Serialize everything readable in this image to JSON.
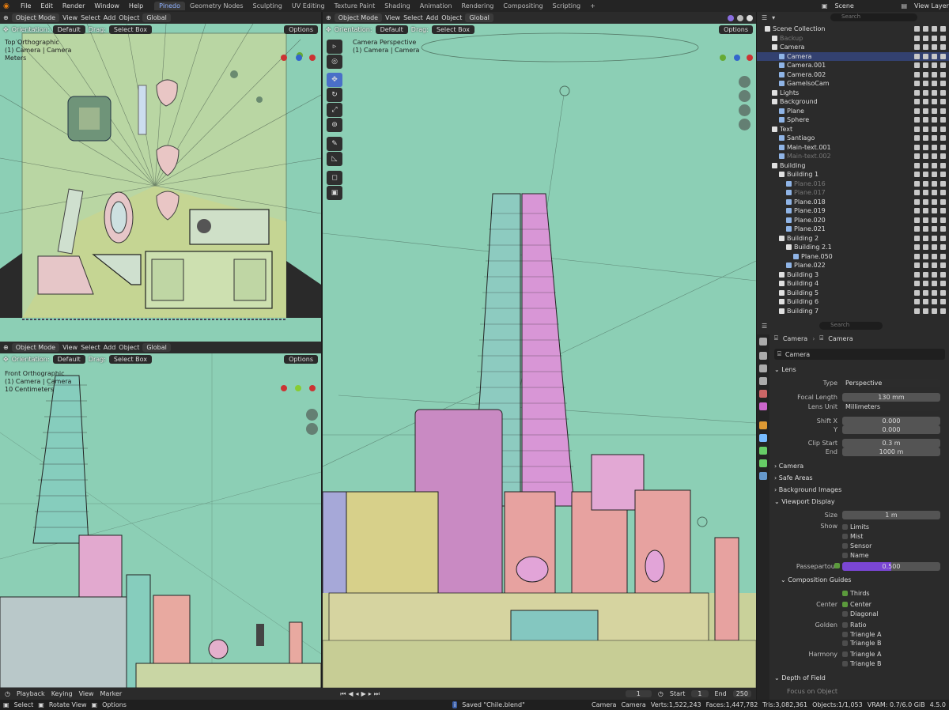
{
  "menu": [
    "File",
    "Edit",
    "Render",
    "Window",
    "Help"
  ],
  "workspaces": [
    "Pinedo",
    "Geometry Nodes",
    "Sculpting",
    "UV Editing",
    "Texture Paint",
    "Shading",
    "Animation",
    "Rendering",
    "Compositing",
    "Scripting"
  ],
  "active_workspace": "Pinedo",
  "scene": "Scene",
  "view_layer": "View Layer",
  "header": {
    "mode": "Object Mode",
    "view": "View",
    "select": "Select",
    "add": "Add",
    "object": "Object",
    "transform": "Global",
    "orientation_label": "Orientation:",
    "orientation": "Default",
    "drag_label": "Drag:",
    "drag": "Select Box",
    "options": "Options"
  },
  "viewports": {
    "top": {
      "name": "Top Orthographic",
      "obj": "(1) Camera | Camera",
      "unit": "Meters"
    },
    "front": {
      "name": "Front Orthographic",
      "obj": "(1) Camera | Camera",
      "unit": "10 Centimeters"
    },
    "cam": {
      "name": "Camera Perspective",
      "obj": "(1) Camera | Camera"
    }
  },
  "outliner": {
    "search_placeholder": "Search",
    "rows": [
      {
        "d": 0,
        "t": "Scene Collection",
        "k": "coll"
      },
      {
        "d": 1,
        "t": "Backup",
        "k": "coll",
        "dim": true
      },
      {
        "d": 1,
        "t": "Camera",
        "k": "coll"
      },
      {
        "d": 2,
        "t": "Camera",
        "k": "cam",
        "sel": true
      },
      {
        "d": 2,
        "t": "Camera.001",
        "k": "cam"
      },
      {
        "d": 2,
        "t": "Camera.002",
        "k": "cam"
      },
      {
        "d": 2,
        "t": "GameIsoCam",
        "k": "cam"
      },
      {
        "d": 1,
        "t": "Lights",
        "k": "coll"
      },
      {
        "d": 1,
        "t": "Background",
        "k": "coll"
      },
      {
        "d": 2,
        "t": "Plane",
        "k": "mesh"
      },
      {
        "d": 2,
        "t": "Sphere",
        "k": "mesh"
      },
      {
        "d": 1,
        "t": "Text",
        "k": "coll"
      },
      {
        "d": 2,
        "t": "Santiago",
        "k": "mesh"
      },
      {
        "d": 2,
        "t": "Main-text.001",
        "k": "mesh"
      },
      {
        "d": 2,
        "t": "Main-text.002",
        "k": "mesh",
        "dim": true
      },
      {
        "d": 1,
        "t": "Building",
        "k": "coll"
      },
      {
        "d": 2,
        "t": "Building 1",
        "k": "coll"
      },
      {
        "d": 3,
        "t": "Plane.016",
        "k": "mesh",
        "dim": true
      },
      {
        "d": 3,
        "t": "Plane.017",
        "k": "mesh",
        "dim": true
      },
      {
        "d": 3,
        "t": "Plane.018",
        "k": "mesh"
      },
      {
        "d": 3,
        "t": "Plane.019",
        "k": "mesh"
      },
      {
        "d": 3,
        "t": "Plane.020",
        "k": "mesh"
      },
      {
        "d": 3,
        "t": "Plane.021",
        "k": "mesh"
      },
      {
        "d": 2,
        "t": "Building 2",
        "k": "coll"
      },
      {
        "d": 3,
        "t": "Building 2.1",
        "k": "coll"
      },
      {
        "d": 4,
        "t": "Plane.050",
        "k": "mesh"
      },
      {
        "d": 3,
        "t": "Plane.022",
        "k": "mesh"
      },
      {
        "d": 2,
        "t": "Building 3",
        "k": "coll"
      },
      {
        "d": 2,
        "t": "Building 4",
        "k": "coll"
      },
      {
        "d": 2,
        "t": "Building 5",
        "k": "coll"
      },
      {
        "d": 2,
        "t": "Building 6",
        "k": "coll"
      },
      {
        "d": 2,
        "t": "Building 7",
        "k": "coll"
      }
    ]
  },
  "props": {
    "search_placeholder": "Search",
    "breadcrumb": [
      "Camera",
      "Camera"
    ],
    "data_name": "Camera",
    "lens_title": "Lens",
    "type_label": "Type",
    "type": "Perspective",
    "focal_label": "Focal Length",
    "focal": "130 mm",
    "lensunit_label": "Lens Unit",
    "lensunit": "Millimeters",
    "shiftx_label": "Shift X",
    "shiftx": "0.000",
    "shifty_label": "Y",
    "shifty": "0.000",
    "clipstart_label": "Clip Start",
    "clipstart": "0.3 m",
    "clipend_label": "End",
    "clipend": "1000 m",
    "sec_camera": "Camera",
    "sec_safe": "Safe Areas",
    "sec_bg": "Background Images",
    "sec_vd": "Viewport Display",
    "size_label": "Size",
    "size": "1 m",
    "show_label": "Show",
    "show": [
      "Limits",
      "Mist",
      "Sensor",
      "Name"
    ],
    "pass_label": "Passepartout",
    "pass": "0.500",
    "pass_value": 0.5,
    "cg_title": "Composition Guides",
    "thirds": "Thirds",
    "center_label": "Center",
    "center": "Center",
    "diagonal": "Diagonal",
    "golden_label": "Golden",
    "ratio": "Ratio",
    "tria": "Triangle A",
    "trib": "Triangle B",
    "harmony_label": "Harmony",
    "hta": "Triangle A",
    "htb": "Triangle B",
    "dof": "Depth of Field",
    "focus": "Focus on Object"
  },
  "timeline": {
    "playback": "Playback",
    "keying": "Keying",
    "view": "View",
    "marker": "Marker",
    "frame": "1",
    "start_label": "Start",
    "start": "1",
    "end_label": "End",
    "end": "250"
  },
  "status": {
    "select": "Select",
    "rotate": "Rotate View",
    "options": "Options",
    "saved": "Saved \"Chile.blend\"",
    "cam1": "Camera",
    "cam2": "Camera",
    "verts": "Verts:1,522,243",
    "faces": "Faces:1,447,782",
    "tris": "Tris:3,082,361",
    "objects": "Objects:1/1,053",
    "vram": "VRAM: 0.7/6.0 GiB",
    "version": "4.5.0"
  }
}
